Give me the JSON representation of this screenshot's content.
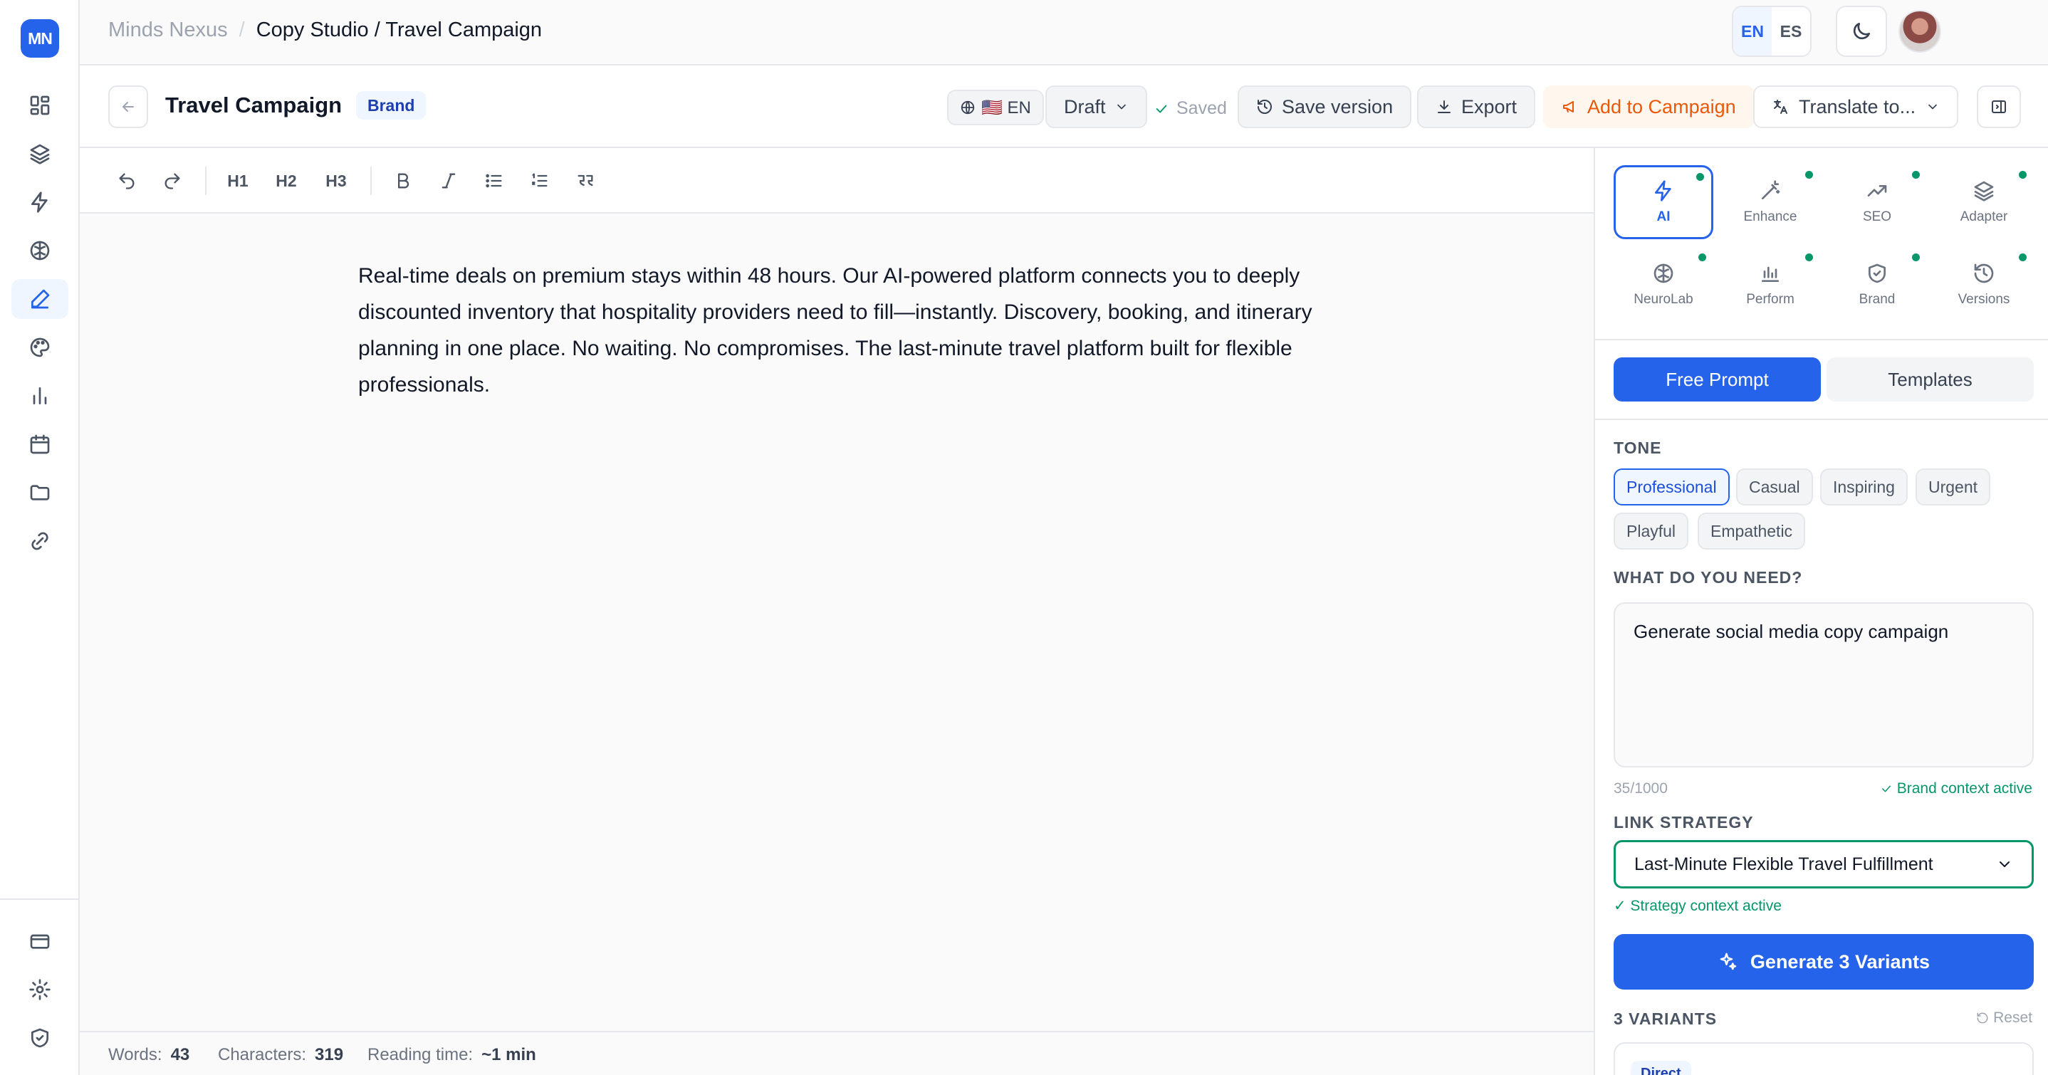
{
  "logo": "MN",
  "breadcrumb": {
    "root": "Minds Nexus",
    "sep": "/",
    "current": "Copy Studio / Travel Campaign"
  },
  "header": {
    "lang_en": "EN",
    "lang_es": "ES"
  },
  "doc": {
    "title": "Travel Campaign",
    "tag": "Brand",
    "lang_badge": "🇺🇸 EN",
    "status": "Draft",
    "saved": "Saved",
    "save_version": "Save version",
    "export": "Export",
    "add_campaign": "Add to Campaign",
    "translate": "Translate to..."
  },
  "toolbar": {
    "h1": "H1",
    "h2": "H2",
    "h3": "H3"
  },
  "editor": {
    "content": "Real-time deals on premium stays within 48 hours. Our AI-powered platform connects you to deeply discounted inventory that hospitality providers need to fill—instantly. Discovery, booking, and itinerary planning in one place. No waiting. No compromises. The last-minute travel platform built for flexible professionals."
  },
  "status": {
    "words_label": "Words:",
    "words": "43",
    "chars_label": "Characters:",
    "chars": "319",
    "time_label": "Reading time:",
    "time": "~1 min"
  },
  "panel": {
    "tools": [
      {
        "label": "AI",
        "icon": "bolt-icon"
      },
      {
        "label": "Enhance",
        "icon": "magic-wand-icon"
      },
      {
        "label": "SEO",
        "icon": "trending-up-icon"
      },
      {
        "label": "Adapter",
        "icon": "layers-icon"
      },
      {
        "label": "NeuroLab",
        "icon": "brain-icon"
      },
      {
        "label": "Perform",
        "icon": "bar-chart-icon"
      },
      {
        "label": "Brand",
        "icon": "shield-icon"
      },
      {
        "label": "Versions",
        "icon": "history-icon"
      }
    ],
    "mode_free": "Free Prompt",
    "mode_templates": "Templates",
    "tone_label": "TONE",
    "tones": [
      "Professional",
      "Casual",
      "Inspiring",
      "Urgent",
      "Playful",
      "Empathetic"
    ],
    "need_label": "WHAT DO YOU NEED?",
    "prompt_value": "Generate social media copy campaign",
    "count": "35/1000",
    "brand_context": "Brand context active",
    "link_label": "LINK STRATEGY",
    "link_value": "Last-Minute Flexible Travel Fulfillment",
    "strategy_context": "✓ Strategy context active",
    "generate": "Generate 3 Variants",
    "variants_label": "3 VARIANTS",
    "reset": "Reset",
    "variant_tag": "Direct"
  },
  "colors": {
    "accent": "#2563eb",
    "success": "#059669",
    "orange": "#ea580c"
  }
}
